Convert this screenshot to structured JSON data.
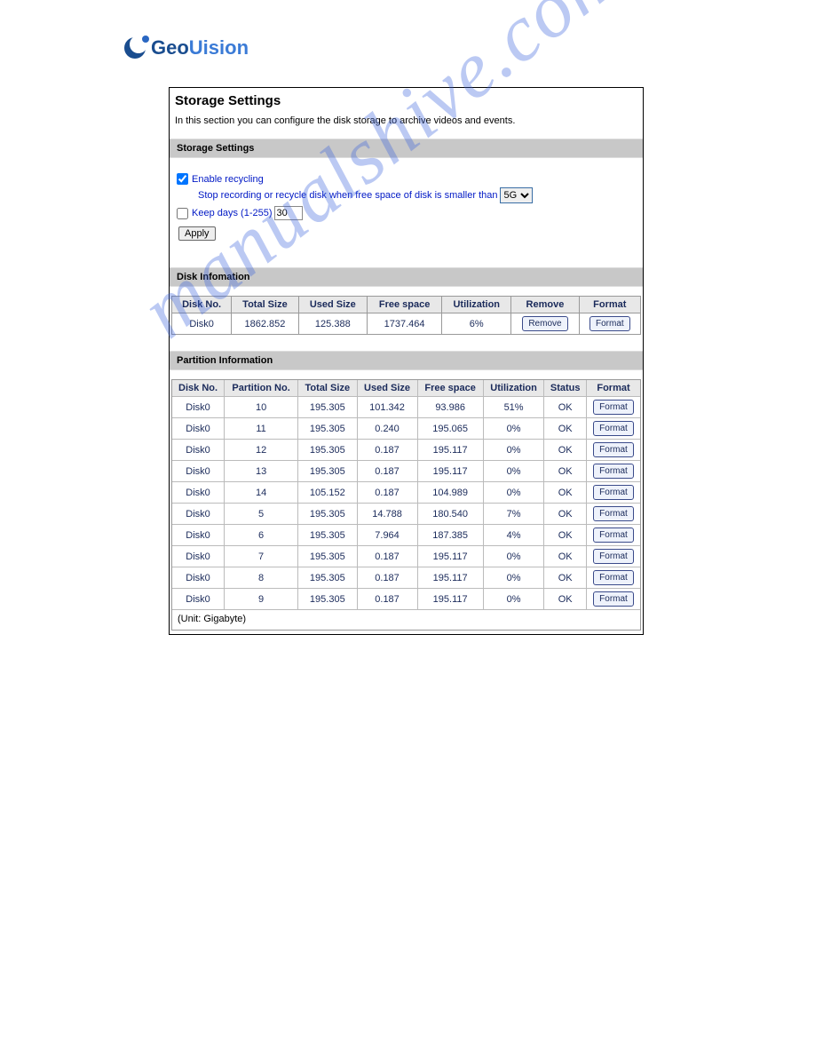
{
  "logo": {
    "geo": "Geo",
    "vision": "Uision"
  },
  "panel": {
    "title": "Storage Settings",
    "desc": "In this section you can configure the disk storage to archive videos and events."
  },
  "storage": {
    "section_title": "Storage Settings",
    "enable_recycling_label": "Enable recycling",
    "enable_recycling_checked": true,
    "stop_text": "Stop recording or recycle disk when free space of disk is smaller than",
    "free_space_selected": "5G",
    "keep_days_label": "Keep days (1-255)",
    "keep_days_checked": false,
    "keep_days_value": "30",
    "apply_label": "Apply"
  },
  "disk": {
    "section_title": "Disk Infomation",
    "headers": [
      "Disk No.",
      "Total Size",
      "Used Size",
      "Free space",
      "Utilization",
      "Remove",
      "Format"
    ],
    "rows": [
      {
        "no": "Disk0",
        "total": "1862.852",
        "used": "125.388",
        "free": "1737.464",
        "util": "6%",
        "remove_label": "Remove",
        "format_label": "Format"
      }
    ]
  },
  "partition": {
    "section_title": "Partition Information",
    "headers": [
      "Disk No.",
      "Partition No.",
      "Total Size",
      "Used Size",
      "Free space",
      "Utilization",
      "Status",
      "Format"
    ],
    "rows": [
      {
        "no": "Disk0",
        "part": "10",
        "total": "195.305",
        "used": "101.342",
        "free": "93.986",
        "util": "51%",
        "status": "OK",
        "format_label": "Format"
      },
      {
        "no": "Disk0",
        "part": "11",
        "total": "195.305",
        "used": "0.240",
        "free": "195.065",
        "util": "0%",
        "status": "OK",
        "format_label": "Format"
      },
      {
        "no": "Disk0",
        "part": "12",
        "total": "195.305",
        "used": "0.187",
        "free": "195.117",
        "util": "0%",
        "status": "OK",
        "format_label": "Format"
      },
      {
        "no": "Disk0",
        "part": "13",
        "total": "195.305",
        "used": "0.187",
        "free": "195.117",
        "util": "0%",
        "status": "OK",
        "format_label": "Format"
      },
      {
        "no": "Disk0",
        "part": "14",
        "total": "105.152",
        "used": "0.187",
        "free": "104.989",
        "util": "0%",
        "status": "OK",
        "format_label": "Format"
      },
      {
        "no": "Disk0",
        "part": "5",
        "total": "195.305",
        "used": "14.788",
        "free": "180.540",
        "util": "7%",
        "status": "OK",
        "format_label": "Format"
      },
      {
        "no": "Disk0",
        "part": "6",
        "total": "195.305",
        "used": "7.964",
        "free": "187.385",
        "util": "4%",
        "status": "OK",
        "format_label": "Format"
      },
      {
        "no": "Disk0",
        "part": "7",
        "total": "195.305",
        "used": "0.187",
        "free": "195.117",
        "util": "0%",
        "status": "OK",
        "format_label": "Format"
      },
      {
        "no": "Disk0",
        "part": "8",
        "total": "195.305",
        "used": "0.187",
        "free": "195.117",
        "util": "0%",
        "status": "OK",
        "format_label": "Format"
      },
      {
        "no": "Disk0",
        "part": "9",
        "total": "195.305",
        "used": "0.187",
        "free": "195.117",
        "util": "0%",
        "status": "OK",
        "format_label": "Format"
      }
    ],
    "unit_note": "(Unit: Gigabyte)"
  },
  "watermark": "manualshive.com"
}
